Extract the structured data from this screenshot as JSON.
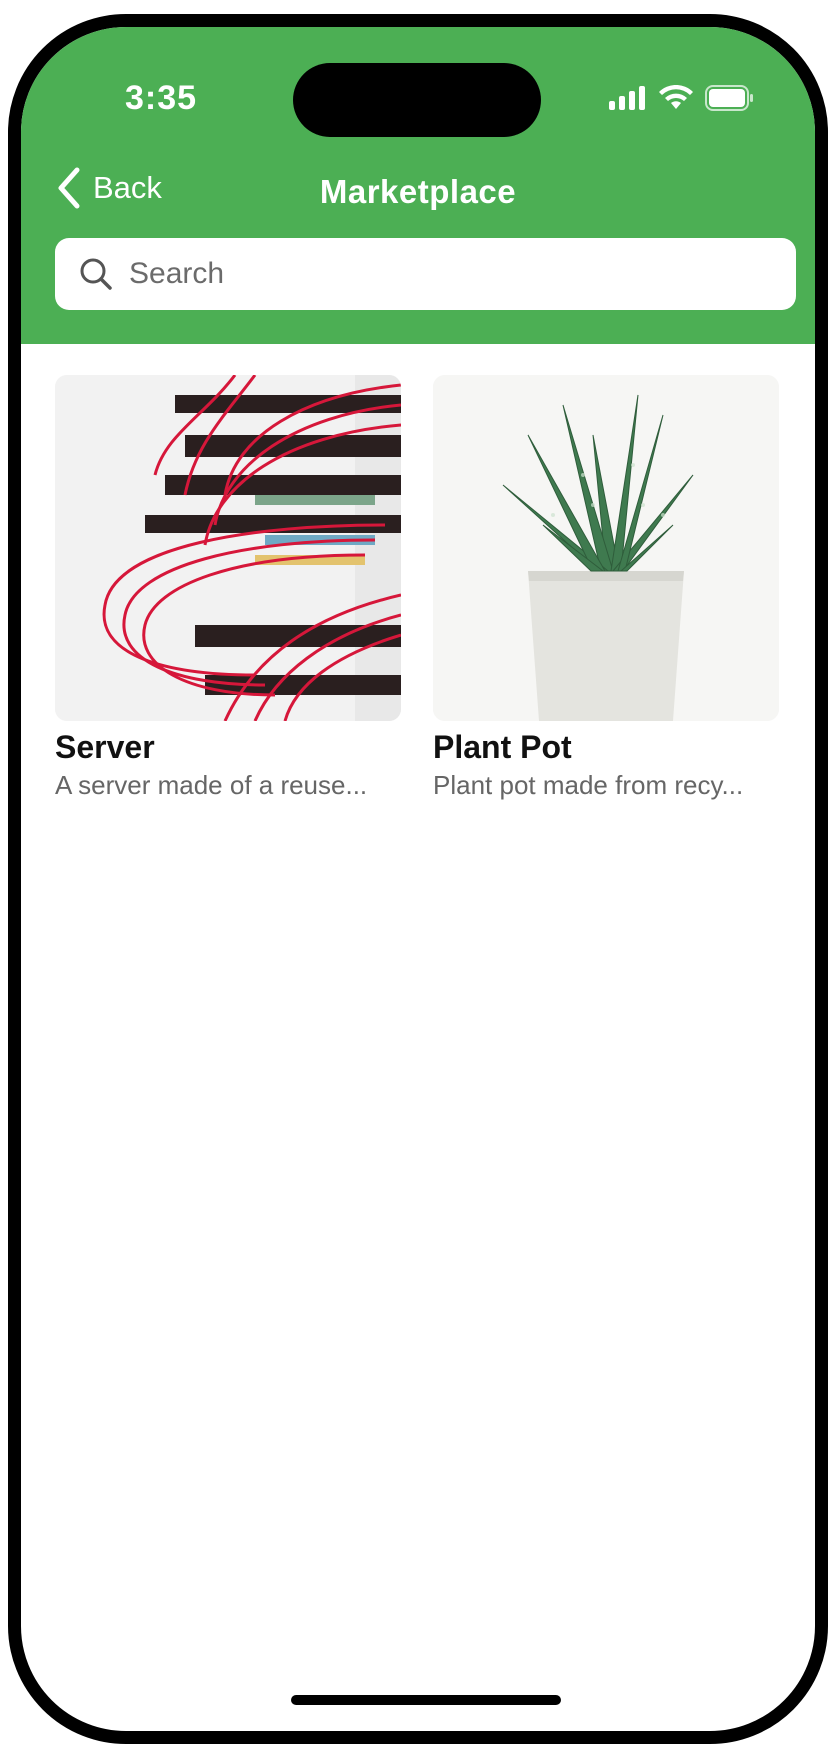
{
  "status_bar": {
    "time": "3:35",
    "icons": [
      "signal-icon",
      "wifi-icon",
      "battery-icon"
    ]
  },
  "nav": {
    "back_label": "Back",
    "title": "Marketplace"
  },
  "search": {
    "placeholder": "Search"
  },
  "products": [
    {
      "title": "Server",
      "description": "A server made of a reuse..."
    },
    {
      "title": "Plant Pot",
      "description": "Plant pot made from recy..."
    }
  ],
  "colors": {
    "header_green": "#4caf54",
    "background": "#ffffff"
  }
}
